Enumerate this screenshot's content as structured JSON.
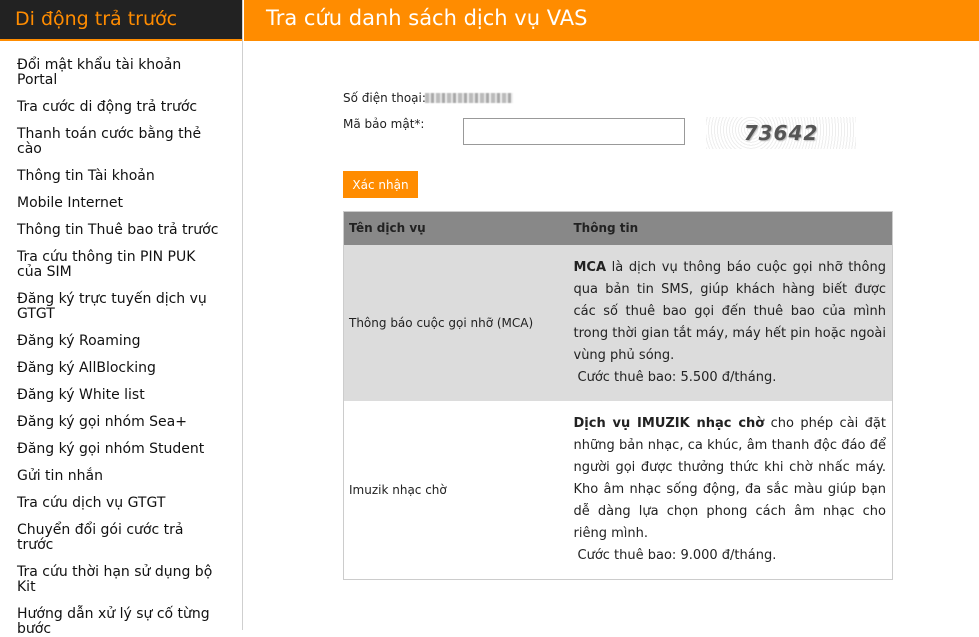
{
  "sidebar": {
    "title": "Di động trả trước",
    "items": [
      "Đổi mật khẩu tài khoản Portal",
      "Tra cước di động trả trước",
      "Thanh toán cước bằng thẻ cào",
      "Thông tin Tài khoản",
      "Mobile Internet",
      "Thông tin Thuê bao trả trước",
      "Tra cứu thông tin PIN PUK của SIM",
      "Đăng ký trực tuyến dịch vụ GTGT",
      "Đăng ký Roaming",
      "Đăng ký AllBlocking",
      "Đăng ký White list",
      "Đăng ký gọi nhóm Sea+",
      "Đăng ký gọi nhóm Student",
      "Gửi tin nhắn",
      "Tra cứu dịch vụ GTGT",
      "Chuyển đổi gói cước trả trước",
      "Tra cứu thời hạn sử dụng bộ Kit",
      "Hướng dẫn xử lý sự cố từng bước"
    ]
  },
  "header": {
    "title": "Tra cứu danh sách dịch vụ VAS"
  },
  "form": {
    "phone_label": "Số điện thoại:",
    "captcha_label": "Mã bảo mật*:",
    "captcha_input_value": "",
    "captcha_text": "73642",
    "submit_label": "Xác nhận"
  },
  "table": {
    "headers": [
      "Tên dịch vụ",
      "Thông tin"
    ],
    "rows": [
      {
        "name": "Thông báo cuộc gọi nhỡ (MCA)",
        "info_bold": "MCA",
        "info_text": " là dịch vụ thông báo cuộc gọi nhỡ thông qua bản tin SMS, giúp khách hàng biết được các số thuê bao gọi đến thuê bao của mình trong thời gian tắt máy, máy hết pin hoặc ngoài vùng phủ sóng.",
        "fee": "Cước thuê bao: 5.500 đ/tháng."
      },
      {
        "name": "Imuzik nhạc chờ",
        "info_bold": "Dịch vụ IMUZIK nhạc chờ",
        "info_text": " cho phép cài đặt những bản nhạc, ca khúc, âm thanh độc đáo để người gọi được thưởng thức khi chờ nhấc máy. Kho âm nhạc sống động, đa sắc màu giúp bạn dễ dàng lựa chọn phong cách âm nhạc cho riêng mình.",
        "fee": "Cước thuê bao: 9.000 đ/tháng."
      }
    ]
  },
  "colors": {
    "accent": "#ff8c00",
    "sidebar_header_bg": "#222222",
    "table_header_bg": "#888888",
    "row_gray": "#dcdcdc"
  }
}
